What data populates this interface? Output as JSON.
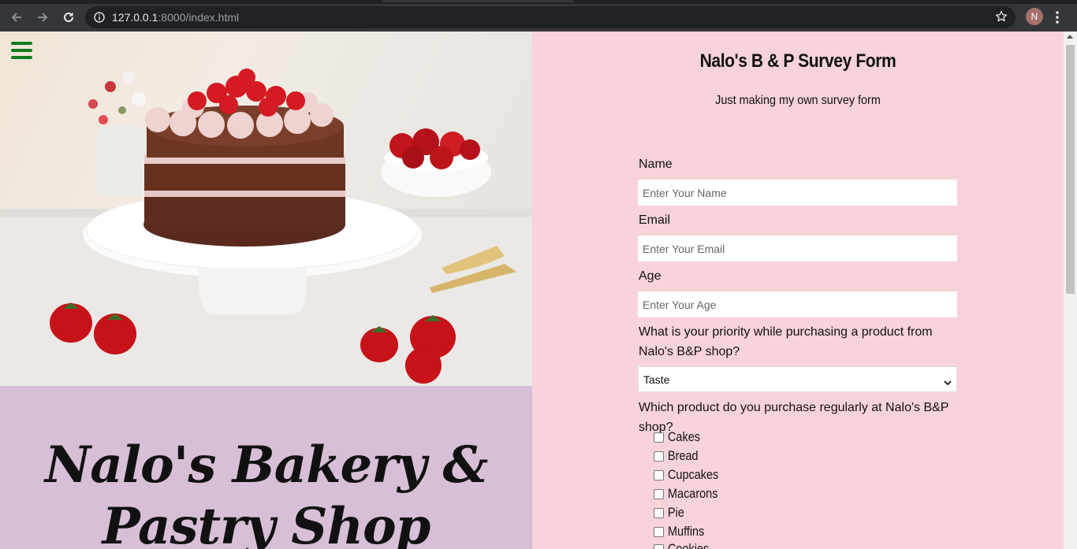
{
  "browser": {
    "url_host": "127.0.0.1",
    "url_rest": ":8000/index.html",
    "profile_initial": "N"
  },
  "icons": {
    "back": "back-arrow-icon",
    "forward": "forward-arrow-icon",
    "reload": "reload-icon",
    "info": "info-icon",
    "bookmark": "star-icon",
    "menu": "kebab-menu-icon",
    "hamburger": "hamburger-menu-icon"
  },
  "colors": {
    "form_background": "#f8d3da",
    "brand_background": "#d8bfd8",
    "menu_accent": "#0f7a1e"
  },
  "brand": {
    "title": "Nalo's Bakery & Pastry Shop"
  },
  "form": {
    "title": "Nalo's B & P Survey Form",
    "subtitle": "Just making my own survey form",
    "name_label": "Name",
    "name_placeholder": "Enter Your Name",
    "email_label": "Email",
    "email_placeholder": "Enter Your Email",
    "age_label": "Age",
    "age_placeholder": "Enter Your Age",
    "priority_question": "What is your priority while purchasing a product from Nalo's B&P shop?",
    "priority_selected": "Taste",
    "products_question": "Which product do you purchase regularly at Nalo's B&P shop?",
    "products": [
      "Cakes",
      "Bread",
      "Cupcakes",
      "Macarons",
      "Pie",
      "Muffins",
      "Cookies"
    ]
  }
}
